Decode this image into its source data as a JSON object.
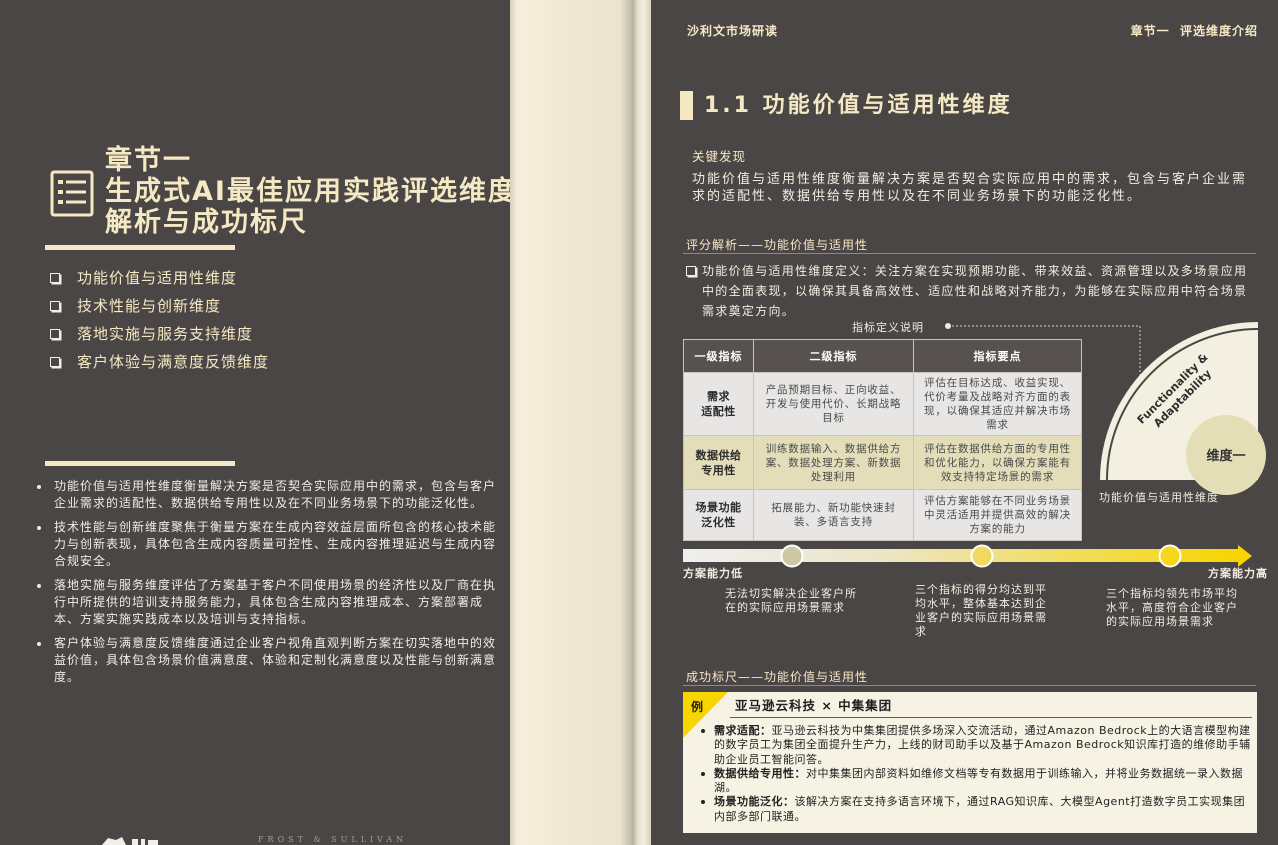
{
  "colors": {
    "page_bg": "#4b4646",
    "cream": "#f5e9c4",
    "accent_yellow": "#f7d500",
    "table_beige": "#e3ddb9",
    "table_gray": "#e8e6e4",
    "example_bg": "#f7f3e4"
  },
  "icons": {
    "chapter_icon": "list-document-icon",
    "check_icon": "checkbox-icon"
  },
  "left_page": {
    "chapter_label": "章节一",
    "title_line1": "生成式AI最佳应用实践评选维度",
    "title_line2": "解析与成功标尺",
    "dimensions": [
      "功能价值与适用性维度",
      "技术性能与创新维度",
      "落地实施与服务支持维度",
      "客户体验与满意度反馈维度"
    ],
    "summary_bullets": [
      "功能价值与适用性维度衡量解决方案是否契合实际应用中的需求，包含与客户企业需求的适配性、数据供给专用性以及在不同业务场景下的功能泛化性。",
      "技术性能与创新维度聚焦于衡量方案在生成内容效益层面所包含的核心技术能力与创新表现，具体包含生成内容质量可控性、生成内容推理延迟与生成内容合规安全。",
      "落地实施与服务维度评估了方案基于客户不同使用场景的经济性以及厂商在执行中所提供的培训支持服务能力，具体包含生成内容推理成本、方案部署成本、方案实施实践成本以及培训与支持指标。",
      "客户体验与满意度反馈维度通过企业客户视角直观判断方案在切实落地中的效益价值，具体包含场景价值满意度、体验和定制化满意度以及性能与创新满意度。"
    ],
    "footer_brand": "FROST & SULLIVAN"
  },
  "right_page": {
    "header_left": "沙利文市场研读",
    "header_right": "章节一  评选维度介绍",
    "section_title": "1.1 功能价值与适用性维度",
    "key_finding_label": "关键发现",
    "key_finding_text": "功能价值与适用性维度衡量解决方案是否契合实际应用中的需求，包含与客户企业需求的适配性、数据供给专用性以及在不同业务场景下的功能泛化性。",
    "scoring": {
      "heading": "评分解析——功能价值与适用性",
      "definition": "功能价值与适用性维度定义：关注方案在实现预期功能、带来效益、资源管理以及多场景应用中的全面表现，以确保其具备高效性、适应性和战略对齐能力，为能够在实际应用中符合场景需求奠定方向。",
      "note_label": "指标定义说明",
      "table": {
        "headers": [
          "一级指标",
          "二级指标",
          "指标要点"
        ],
        "rows": [
          {
            "level1": "需求\n适配性",
            "level2": "产品预期目标、正向收益、开发与使用代价、长期战略目标",
            "points": "评估在目标达成、收益实现、代价考量及战略对齐方面的表现，以确保其适应并解决市场需求"
          },
          {
            "level1": "数据供给\n专用性",
            "level2": "训练数据输入、数据供给方案、数据处理方案、新数据处理利用",
            "points": "评估在数据供给方面的专用性和优化能力，以确保方案能有效支持特定场景的需求"
          },
          {
            "level1": "场景功能\n泛化性",
            "level2": "拓展能力、新功能快速封装、多语言支持",
            "points": "评估方案能够在不同业务场景中灵活适用并提供高效的解决方案的能力"
          }
        ]
      },
      "diagram": {
        "english_line1": "Functionality &",
        "english_line2": "Adaptability",
        "badge": "维度一",
        "caption": "功能价值与适用性维度"
      },
      "scale": {
        "low_label": "方案能力低",
        "high_label": "方案能力高",
        "descriptions": [
          "无法切实解决企业客户所在的实际应用场景需求",
          "三个指标的得分均达到平均水平，整体基本达到企业客户的实际应用场景需求",
          "三个指标均领先市场平均水平，高度符合企业客户的实际应用场景需求"
        ]
      }
    },
    "benchmark": {
      "heading": "成功标尺——功能价值与适用性",
      "badge": "例",
      "case_title": "亚马逊云科技 × 中集集团",
      "items": [
        {
          "label": "需求适配：",
          "text": "亚马逊云科技为中集集团提供多场深入交流活动，通过Amazon Bedrock上的大语言模型构建的数字员工为集团全面提升生产力，上线的财司助手以及基于Amazon Bedrock知识库打造的维修助手辅助企业员工智能问答。"
        },
        {
          "label": "数据供给专用性：",
          "text": "对中集集团内部资料如维修文档等专有数据用于训练输入，并将业务数据统一录入数据湖。"
        },
        {
          "label": "场景功能泛化：",
          "text": "该解决方案在支持多语言环境下，通过RAG知识库、大模型Agent打造数字员工实现集团内部多部门联通。"
        }
      ]
    }
  }
}
